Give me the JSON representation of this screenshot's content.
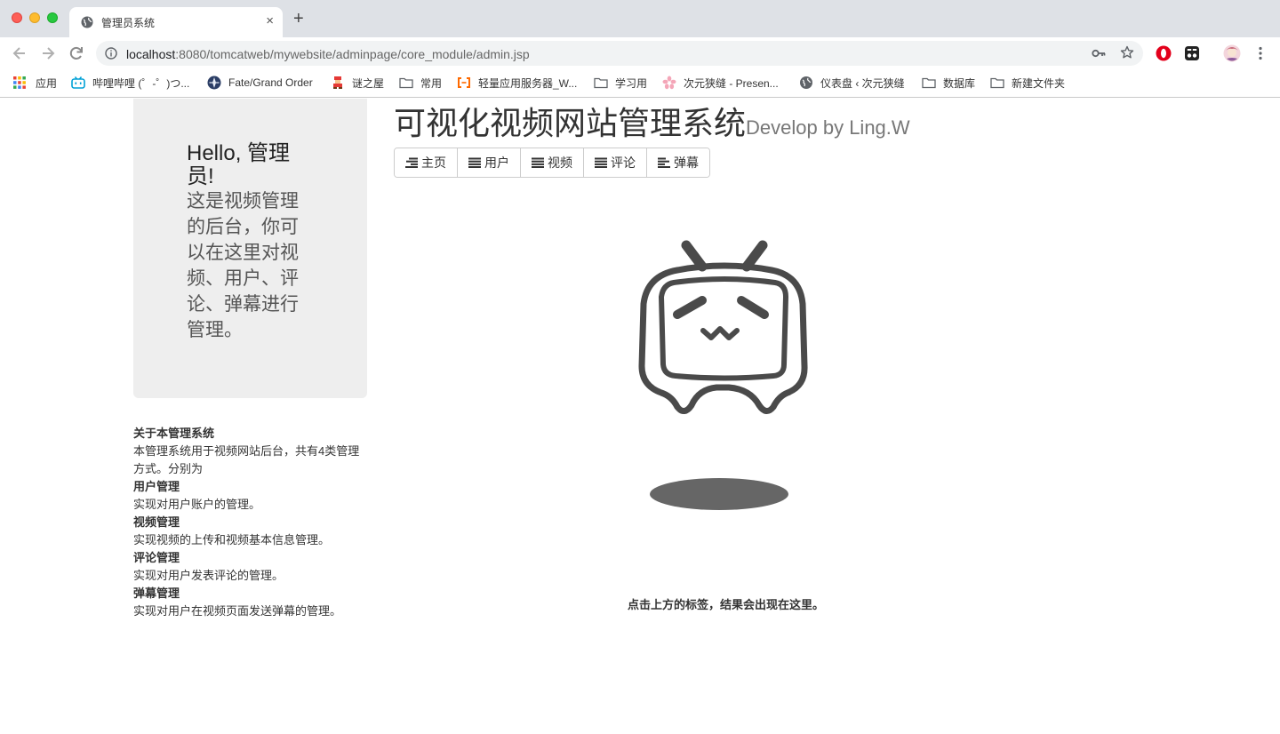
{
  "browser": {
    "tab_title": "管理员系统",
    "new_tab_label": "+",
    "tab_close_label": "×",
    "url_host": "localhost",
    "url_rest": ":8080/tomcatweb/mywebsite/adminpage/core_module/admin.jsp"
  },
  "bookmarks": [
    {
      "label": "应用",
      "icon": "apps-grid-icon"
    },
    {
      "label": "哔哩哔哩 (゜-゜)つ...",
      "icon": "bilibili-icon"
    },
    {
      "label": "Fate/Grand Order",
      "icon": "fgo-icon"
    },
    {
      "label": "谜之屋",
      "icon": "mystery-house-icon"
    },
    {
      "label": "常用",
      "icon": "folder-icon"
    },
    {
      "label": "轻量应用服务器_W...",
      "icon": "aliyun-icon"
    },
    {
      "label": "学习用",
      "icon": "folder-icon"
    },
    {
      "label": "次元狭缝 - Presen...",
      "icon": "sakura-icon"
    },
    {
      "label": "仪表盘 ‹ 次元狭缝",
      "icon": "globe-icon"
    },
    {
      "label": "数据库",
      "icon": "folder-icon"
    },
    {
      "label": "新建文件夹",
      "icon": "folder-icon"
    }
  ],
  "jumbotron": {
    "heading": "Hello, 管理员!",
    "text": "这是视频管理的后台，你可以在这里对视频、用户、评论、弹幕进行管理。"
  },
  "about": {
    "title": "关于本管理系统",
    "intro": "本管理系统用于视频网站后台，共有4类管理方式。分别为",
    "sections": [
      {
        "name": "用户管理",
        "desc": "实现对用户账户的管理。"
      },
      {
        "name": "视频管理",
        "desc": "实现视频的上传和视频基本信息管理。"
      },
      {
        "name": "评论管理",
        "desc": "实现对用户发表评论的管理。"
      },
      {
        "name": "弹幕管理",
        "desc": "实现对用户在视频页面发送弹幕的管理。"
      }
    ]
  },
  "header": {
    "title": "可视化视频网站管理系统",
    "subtitle": "Develop by Ling.W"
  },
  "nav_buttons": [
    {
      "label": "主页",
      "icon": "align-right-icon"
    },
    {
      "label": "用户",
      "icon": "list-icon"
    },
    {
      "label": "视频",
      "icon": "list-icon"
    },
    {
      "label": "评论",
      "icon": "list-icon"
    },
    {
      "label": "弹幕",
      "icon": "align-left-icon"
    }
  ],
  "hint": "点击上方的标签，结果会出现在这里。"
}
